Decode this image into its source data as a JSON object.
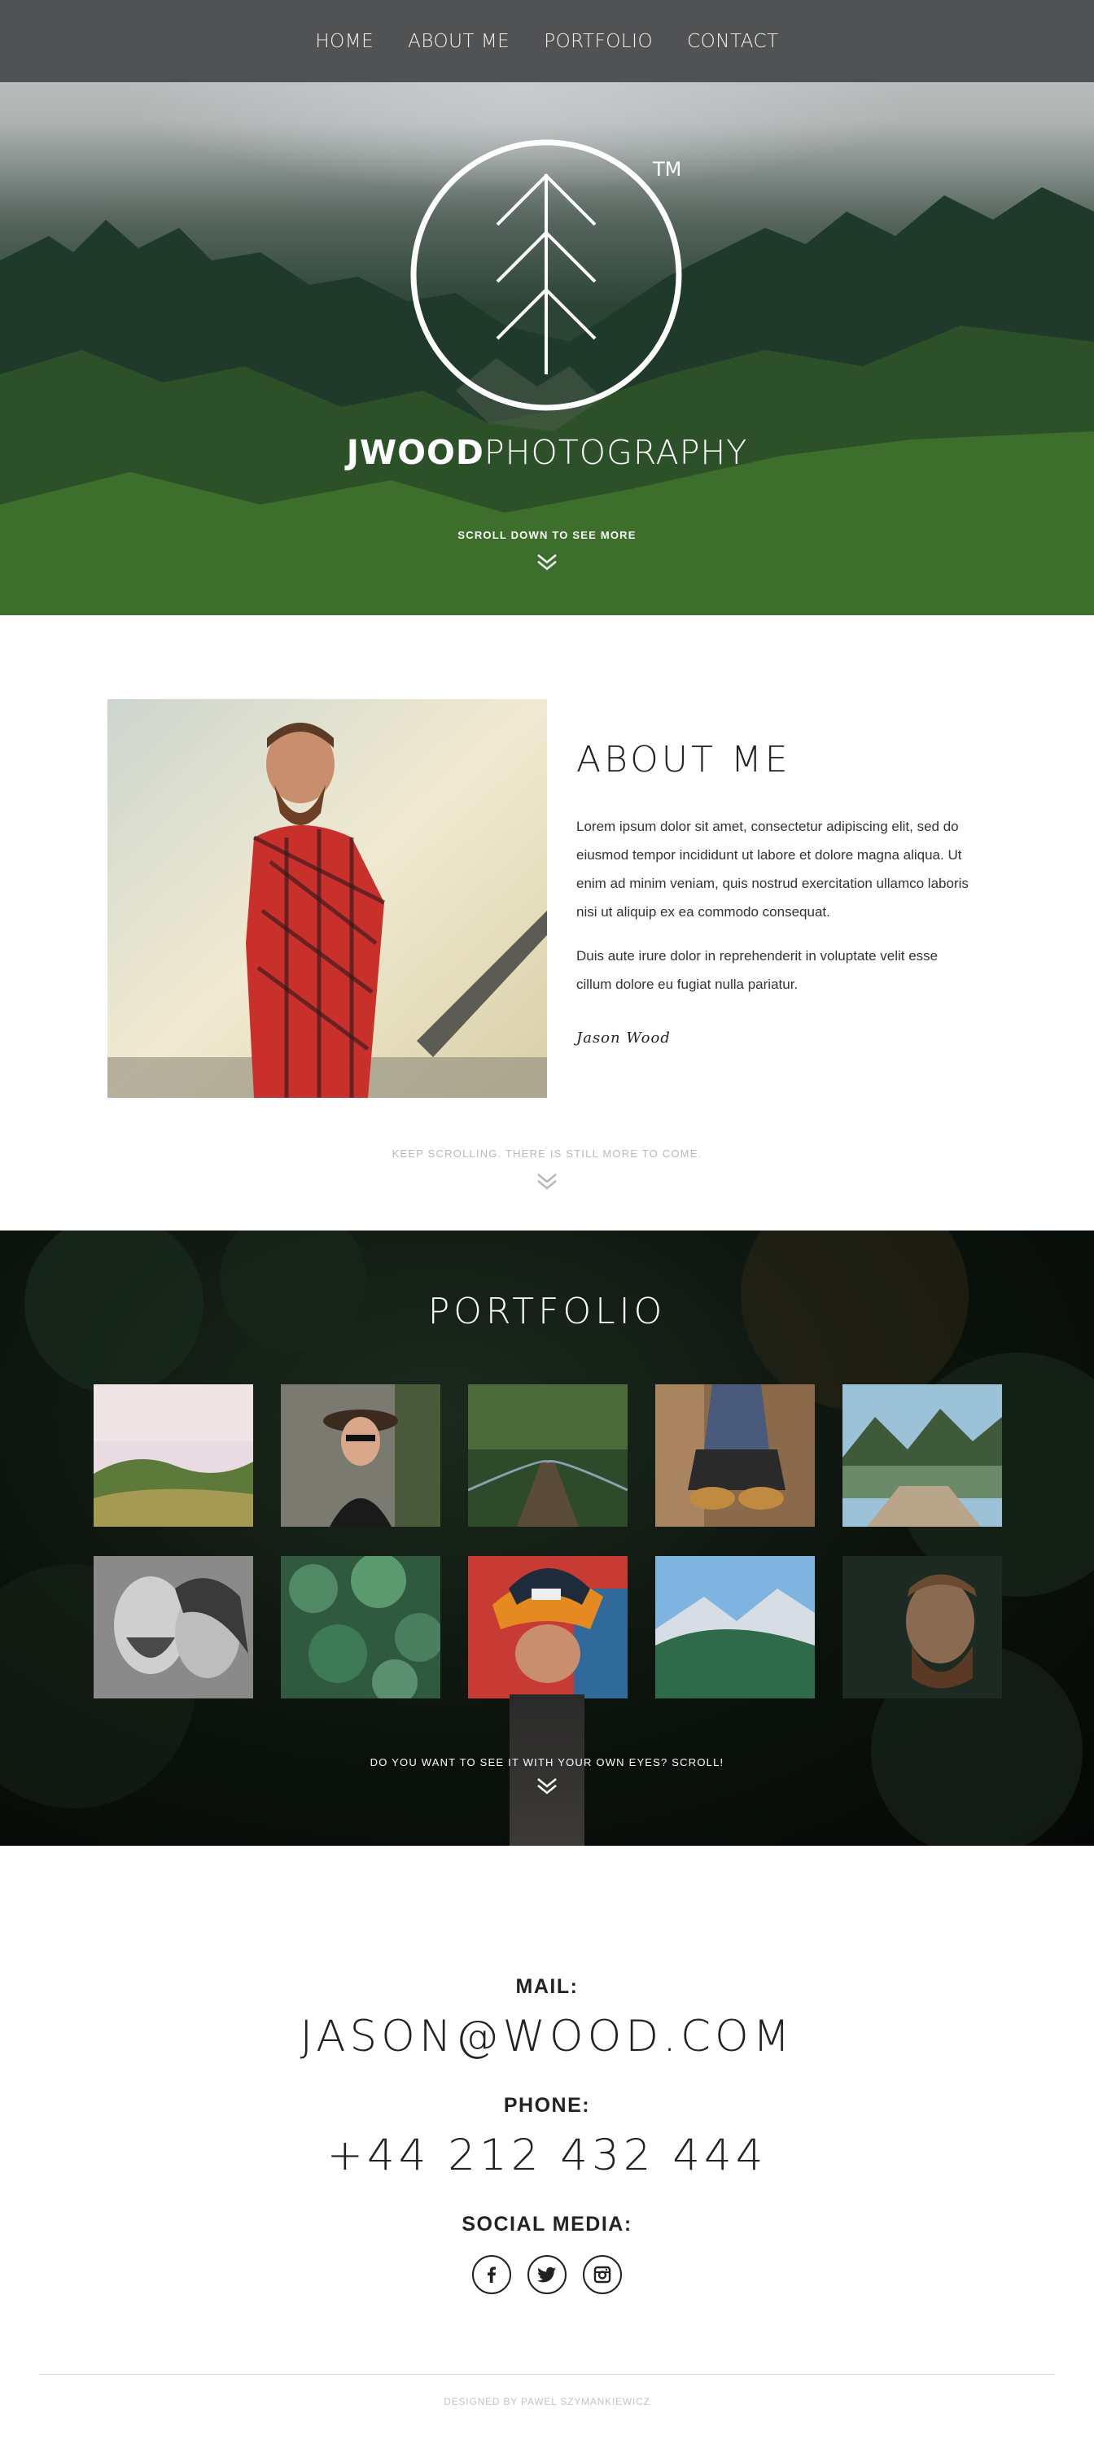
{
  "nav": {
    "items": [
      {
        "label": "HOME"
      },
      {
        "label": "ABOUT ME"
      },
      {
        "label": "PORTFOLIO"
      },
      {
        "label": "CONTACT"
      }
    ]
  },
  "hero": {
    "tm": "TM",
    "brand_bold": "JWOOD",
    "brand_light": "PHOTOGRAPHY",
    "scroll_text": "SCROLL DOWN TO SEE MORE"
  },
  "about": {
    "title": "ABOUT ME",
    "paragraph1": "Lorem ipsum dolor sit amet, consectetur adipiscing elit, sed do eiusmod tempor incididunt ut labore et dolore magna aliqua. Ut enim ad minim veniam, quis nostrud exercitation ullamco laboris nisi ut aliquip ex ea commodo consequat.",
    "paragraph2": "Duis aute irure dolor in reprehenderit in voluptate velit esse cillum dolore eu fugiat nulla pariatur.",
    "signature": "Jason Wood",
    "scroll_text": "KEEP SCROLLING. THERE IS STILL MORE TO COME."
  },
  "portfolio": {
    "title": "PORTFOLIO",
    "scroll_text": "DO YOU WANT TO SEE IT WITH YOUR OWN EYES? SCROLL!",
    "thumbnails": [
      {
        "subject": "hills-at-sunrise"
      },
      {
        "subject": "woman-in-hat"
      },
      {
        "subject": "forest-bridge"
      },
      {
        "subject": "hiker-boots"
      },
      {
        "subject": "lake-dock"
      },
      {
        "subject": "couple-black-and-white"
      },
      {
        "subject": "succulent-plants"
      },
      {
        "subject": "man-in-cap"
      },
      {
        "subject": "mountain-valley"
      },
      {
        "subject": "bearded-man-portrait"
      }
    ]
  },
  "contact": {
    "mail_label": "MAIL:",
    "mail_value": "JASON@WOOD.COM",
    "phone_label": "PHONE:",
    "phone_value": "+44 212 432 444",
    "social_label": "SOCIAL MEDIA:",
    "social_icons": [
      "facebook-icon",
      "twitter-icon",
      "instagram-icon"
    ]
  },
  "footer": {
    "text": "DESIGNED BY PAWEL SZYMANKIEWICZ"
  }
}
